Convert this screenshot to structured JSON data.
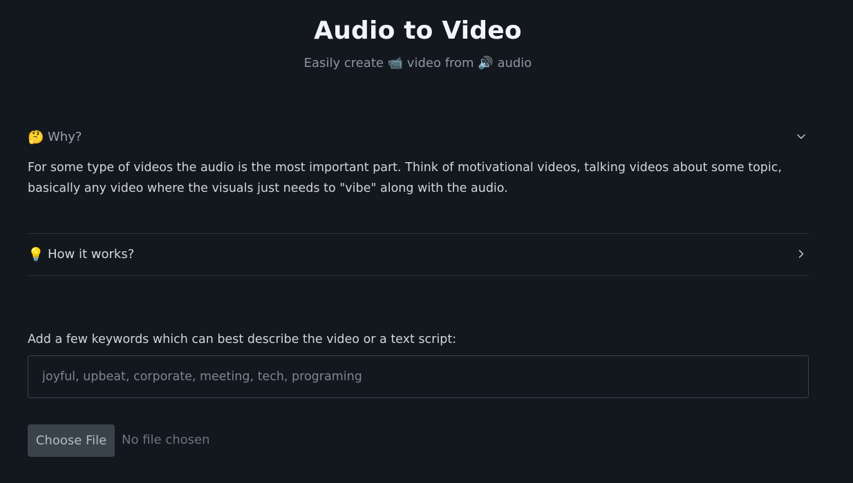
{
  "header": {
    "title": "Audio to Video",
    "subtitle": "Easily create 📹 video from 🔊 audio"
  },
  "accordion": {
    "why": {
      "emoji": "🤔",
      "label": "Why?",
      "expanded": true,
      "body": "For some type of videos the audio is the most important part. Think of motivational videos, talking videos about some topic, basically any video where the visuals just needs to \"vibe\" along with the audio."
    },
    "how": {
      "emoji": "💡",
      "label": "How it works?",
      "expanded": false
    }
  },
  "form": {
    "keywords_label": "Add a few keywords which can best describe the video or a text script:",
    "keywords_placeholder": "joyful, upbeat, corporate, meeting, tech, programing",
    "keywords_value": "",
    "file_button_label": "Choose File",
    "file_status": "No file chosen"
  },
  "icons": {
    "why_chevron": "chevron-down-icon",
    "how_chevron": "chevron-right-icon"
  },
  "colors": {
    "background": "#13181f",
    "title": "#f2f4f7",
    "text": "#d2d6db",
    "muted": "#8d97a3",
    "button_bg": "#3a434c"
  }
}
